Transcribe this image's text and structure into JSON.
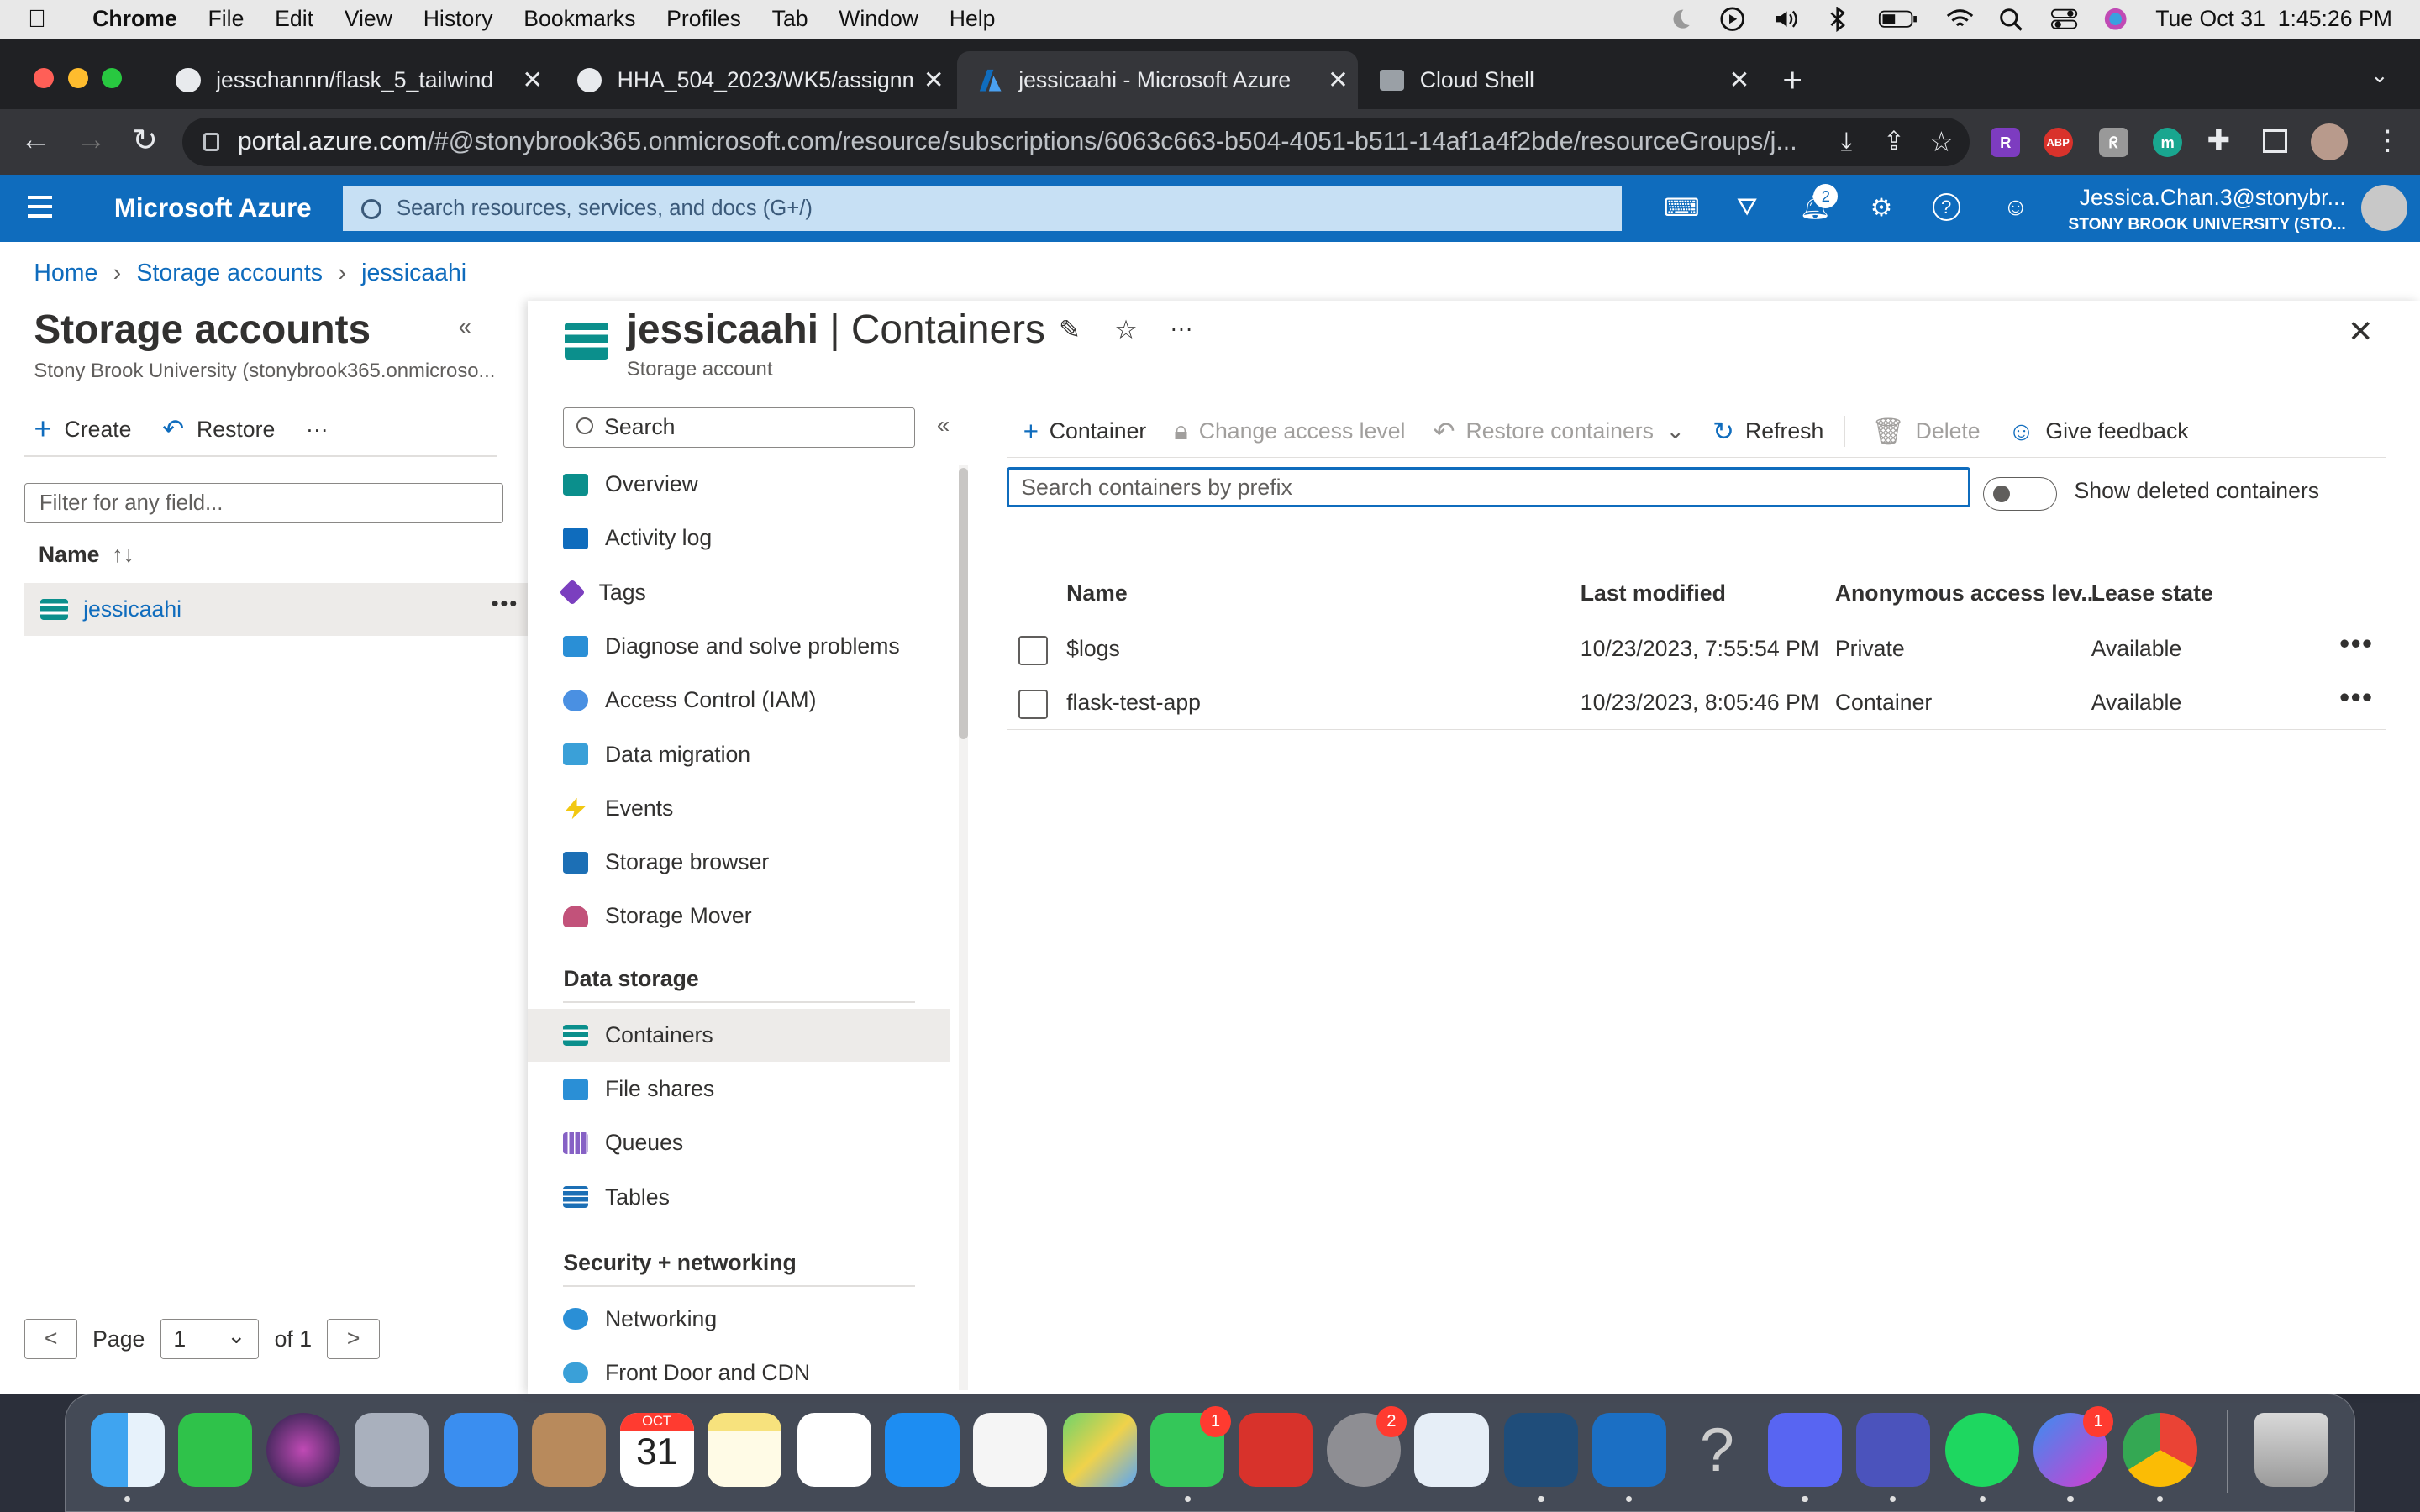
{
  "menubar": {
    "app": "Chrome",
    "items": [
      "File",
      "Edit",
      "View",
      "History",
      "Bookmarks",
      "Profiles",
      "Tab",
      "Window",
      "Help"
    ],
    "clock": "Tue Oct 31  1:45:26 PM"
  },
  "tabs": [
    {
      "title": "jesschannn/flask_5_tailwind",
      "icon": "github-icon"
    },
    {
      "title": "HHA_504_2023/WK5/assignm",
      "icon": "github-icon"
    },
    {
      "title": "jessicaahi - Microsoft Azure",
      "icon": "azure-icon"
    },
    {
      "title": "Cloud Shell",
      "icon": "terminal-icon"
    }
  ],
  "address": {
    "host": "portal.azure.com",
    "path": "/#@stonybrook365.onmicrosoft.com/resource/subscriptions/6063c663-b504-4051-b511-14af1a4f2bde/resourceGroups/j..."
  },
  "extensions": [
    "R",
    "ABP",
    "ᖇ",
    "m"
  ],
  "azure": {
    "brand": "Microsoft Azure",
    "search_placeholder": "Search resources, services, and docs (G+/)",
    "notifications": "2",
    "user_name": "Jessica.Chan.3@stonybr...",
    "user_org": "STONY BROOK UNIVERSITY (STO..."
  },
  "breadcrumb": [
    "Home",
    "Storage accounts",
    "jessicaahi"
  ],
  "left": {
    "title": "Storage accounts",
    "subtitle": "Stony Brook University (stonybrook365.onmicroso...",
    "create": "Create",
    "restore": "Restore",
    "more": "···",
    "filter_placeholder": "Filter for any field...",
    "col_name": "Name",
    "sort": "↑↓",
    "item": "jessicaahi",
    "item_more": "•••",
    "page_label": "Page",
    "page_value": "1",
    "page_of": "of 1",
    "prev": "<",
    "next": ">"
  },
  "main": {
    "title_resource": "jessicaahi",
    "title_section": " | Containers",
    "subtitle": "Storage account",
    "more": "···",
    "menu_search": "Search",
    "menu_items": [
      {
        "label": "Overview",
        "icon": "overview-icon",
        "color": "#0b8f8c"
      },
      {
        "label": "Activity log",
        "icon": "activity-log-icon",
        "color": "#0f6cbd"
      },
      {
        "label": "Tags",
        "icon": "tag-icon",
        "color": "#7b3fbf"
      },
      {
        "label": "Diagnose and solve problems",
        "icon": "wrench-icon",
        "color": "#2a8fd6"
      },
      {
        "label": "Access Control (IAM)",
        "icon": "people-icon",
        "color": "#4a90e2"
      },
      {
        "label": "Data migration",
        "icon": "migration-icon",
        "color": "#3aa0d8"
      },
      {
        "label": "Events",
        "icon": "bolt-icon",
        "color": "#f2c811"
      },
      {
        "label": "Storage browser",
        "icon": "storage-browser-icon",
        "color": "#1c6fb5"
      },
      {
        "label": "Storage Mover",
        "icon": "cloud-mover-icon",
        "color": "#c2527a"
      }
    ],
    "section_data": "Data storage",
    "data_items": [
      {
        "label": "Containers",
        "icon": "containers-icon",
        "color": "#0b8f8c"
      },
      {
        "label": "File shares",
        "icon": "file-shares-icon",
        "color": "#2a8fd6"
      },
      {
        "label": "Queues",
        "icon": "queues-icon",
        "color": "#8661c5"
      },
      {
        "label": "Tables",
        "icon": "tables-icon",
        "color": "#1c6fb5"
      }
    ],
    "section_security": "Security + networking",
    "security_items": [
      {
        "label": "Networking",
        "icon": "networking-icon",
        "color": "#2a8fd6"
      },
      {
        "label": "Front Door and CDN",
        "icon": "cdn-icon",
        "color": "#3aa0d8"
      }
    ],
    "toolbar": {
      "container": "Container",
      "change_access": "Change access level",
      "restore": "Restore containers",
      "refresh": "Refresh",
      "delete": "Delete",
      "feedback": "Give feedback"
    },
    "prefix_placeholder": "Search containers by prefix",
    "show_deleted": "Show deleted containers",
    "columns": [
      "Name",
      "Last modified",
      "Anonymous access lev...",
      "Lease state"
    ],
    "rows": [
      {
        "name": "$logs",
        "modified": "10/23/2023, 7:55:54 PM",
        "access": "Private",
        "lease": "Available"
      },
      {
        "name": "flask-test-app",
        "modified": "10/23/2023, 8:05:46 PM",
        "access": "Container",
        "lease": "Available"
      }
    ],
    "row_more": "•••"
  },
  "dock": {
    "calendar_month": "OCT",
    "calendar_day": "31",
    "badges": {
      "messages": "1",
      "settings": "2",
      "messenger": "1"
    }
  }
}
